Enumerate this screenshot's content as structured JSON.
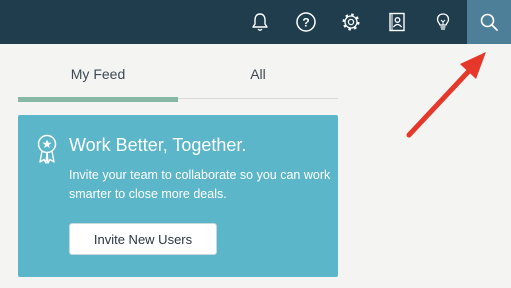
{
  "topbar": {
    "icons": [
      "bell-icon",
      "help-icon",
      "gear-icon",
      "contact-card-icon",
      "lightbulb-icon",
      "search-icon"
    ],
    "help_glyph": "?",
    "background": "#203d4e",
    "active_background": "#4e7f98"
  },
  "feed_tabs": {
    "my_feed": "My Feed",
    "all": "All",
    "active": "My Feed",
    "active_color": "#87b8a5"
  },
  "promo_card": {
    "title": "Work Better, Together.",
    "text": "Invite your team to collaborate so you can work smarter to close more deals.",
    "button_label": "Invite New Users",
    "background": "#5bb6c9"
  },
  "annotation": {
    "arrow_color": "#e5382a",
    "points_to": "search-icon"
  }
}
